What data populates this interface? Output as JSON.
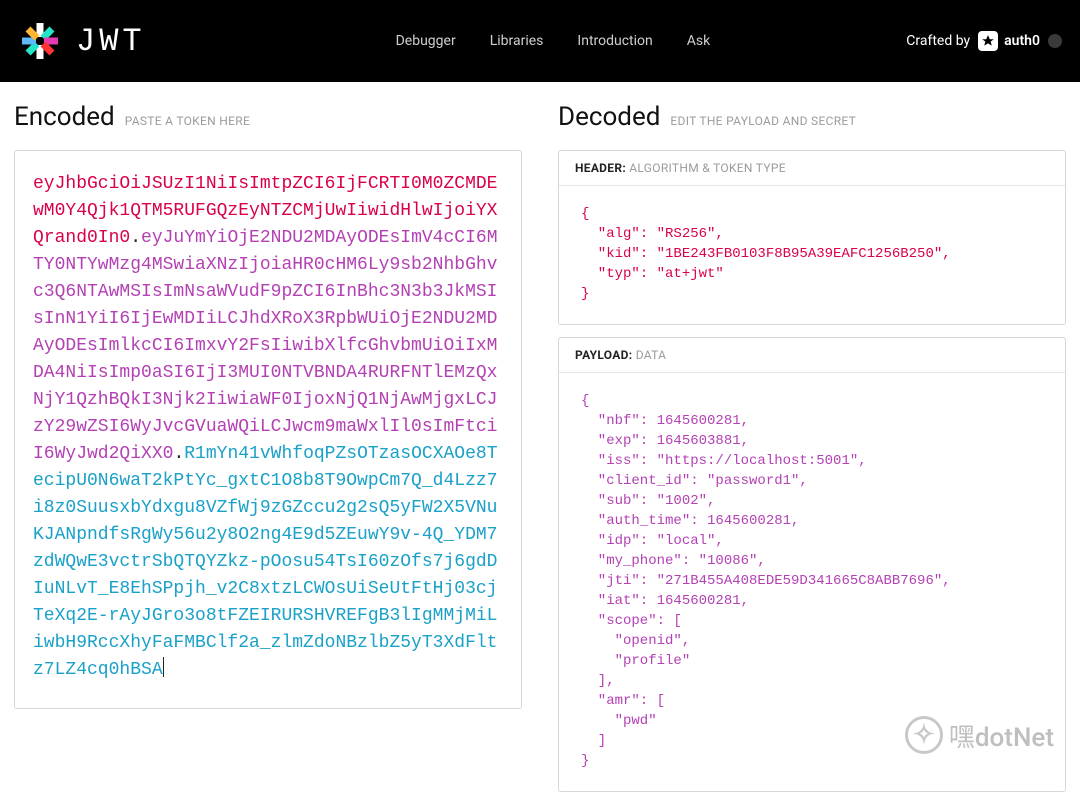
{
  "header": {
    "brand": "JWT",
    "nav": {
      "debugger": "Debugger",
      "libraries": "Libraries",
      "intro": "Introduction",
      "ask": "Ask"
    },
    "crafted": "Crafted by",
    "auth0": "auth0"
  },
  "encoded": {
    "title": "Encoded",
    "subtitle": "PASTE A TOKEN HERE",
    "token_header": "eyJhbGciOiJSUzI1NiIsImtpZCI6IjFCRTI0M0ZCMDEwM0Y4Qjk1QTM5RUFGQzEyNTZCMjUwIiwidHlwIjoiYXQrand0In0",
    "token_payload": "eyJuYmYiOjE2NDU2MDAyODEsImV4cCI6MTY0NTYwMzg4MSwiaXNzIjoiaHR0cHM6Ly9sb2NhbGhvc3Q6NTAwMSIsImNsaWVudF9pZCI6InBhc3N3b3JkMSIsInN1YiI6IjEwMDIiLCJhdXRoX3RpbWUiOjE2NDU2MDAyODEsImlkcCI6ImxvY2FsIiwibXlfcGhvbmUiOiIxMDA4NiIsImp0aSI6IjI3MUI0NTVBNDA4RURFNTlEMzQxNjY1QzhBQkI3Njk2IiwiaWF0IjoxNjQ1NjAwMjgxLCJzY29wZSI6WyJvcGVuaWQiLCJwcm9maWxlIl0sImFtciI6WyJwd2QiXX0",
    "token_signature": "R1mYn41vWhfoqPZsOTzasOCXAOe8TecipU0N6waT2kPtYc_gxtC1O8b8T9OwpCm7Q_d4Lzz7i8z0SuusxbYdxgu8VZfWj9zGZccu2g2sQ5yFW2X5VNuKJANpndfsRgWy56u2y8O2ng4E9d5ZEuwY9v-4Q_YDM7zdWQwE3vctrSbQTQYZkz-pOosu54TsI60zOfs7j6gdDIuNLvT_E8EhSPpjh_v2C8xtzLCWOsUiSeUtFtHj03cjTeXq2E-rAyJGro3o8tFZEIRURSHVREFgB3lIgMMjMiLiwbH9RccXhyFaFMBClf2a_zlmZdoNBzlbZ5yT3XdFltz7LZ4cq0hBSA"
  },
  "decoded": {
    "title": "Decoded",
    "subtitle": "EDIT THE PAYLOAD AND SECRET",
    "header_label": "HEADER:",
    "header_sub": "ALGORITHM & TOKEN TYPE",
    "payload_label": "PAYLOAD:",
    "payload_sub": "DATA",
    "header_json": "{\n  \"alg\": \"RS256\",\n  \"kid\": \"1BE243FB0103F8B95A39EAFC1256B250\",\n  \"typ\": \"at+jwt\"\n}",
    "payload_json": "{\n  \"nbf\": 1645600281,\n  \"exp\": 1645603881,\n  \"iss\": \"https://localhost:5001\",\n  \"client_id\": \"password1\",\n  \"sub\": \"1002\",\n  \"auth_time\": 1645600281,\n  \"idp\": \"local\",\n  \"my_phone\": \"10086\",\n  \"jti\": \"271B455A408EDE59D341665C8ABB7696\",\n  \"iat\": 1645600281,\n  \"scope\": [\n    \"openid\",\n    \"profile\"\n  ],\n  \"amr\": [\n    \"pwd\"\n  ]\n}"
  },
  "watermark": "嘿dotNet"
}
